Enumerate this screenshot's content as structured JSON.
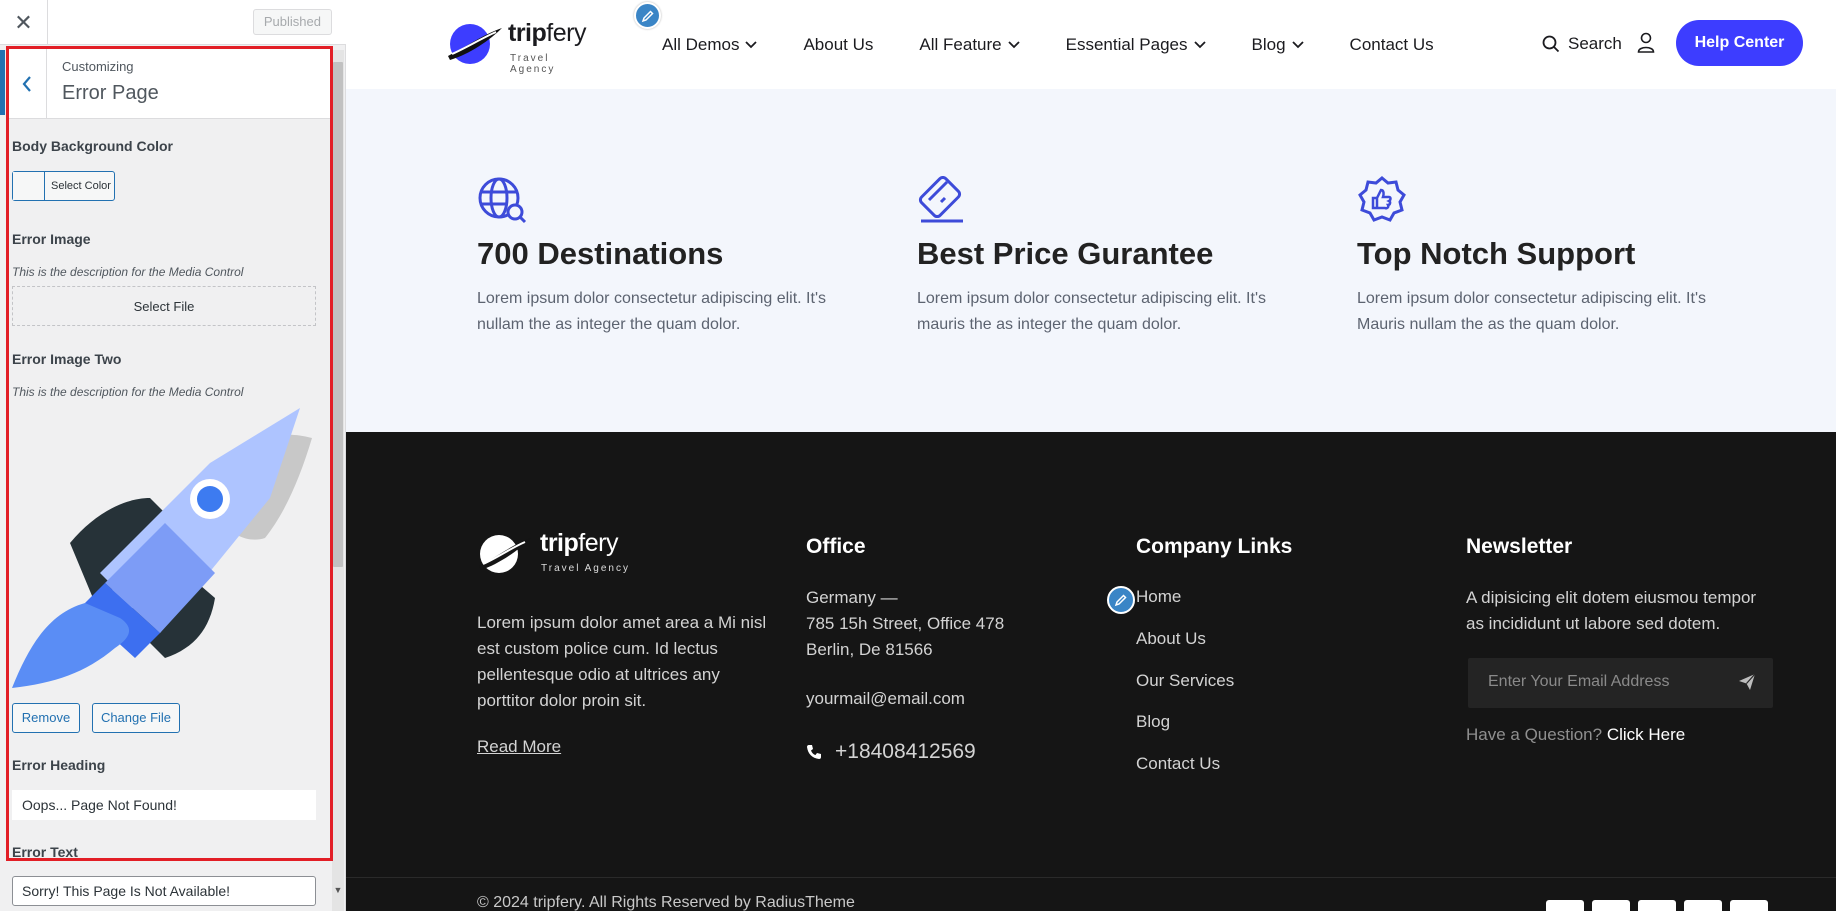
{
  "sidebar": {
    "close_icon": "close-icon",
    "published_label": "Published",
    "customizing_label": "Customizing",
    "section_title": "Error Page",
    "body_bg_label": "Body Background Color",
    "select_color_label": "Select Color",
    "error_image_label": "Error Image",
    "media_desc": "This is the description for the Media Control",
    "select_file_label": "Select File",
    "error_image_two_label": "Error Image Two",
    "media_desc_two": "This is the description for the Media Control",
    "remove_label": "Remove",
    "change_file_label": "Change File",
    "error_heading_label": "Error Heading",
    "error_heading_value": "Oops... Page Not Found!",
    "error_text_label": "Error Text",
    "error_text_value": "Sorry! This Page Is Not Available!",
    "highlight_color": "#e21e26",
    "accent_color": "#2271b1"
  },
  "site": {
    "logo_word_trip": "trip",
    "logo_word_fery": "fery",
    "logo_tag": "Travel Agency",
    "nav": [
      {
        "label": "All Demos",
        "dropdown": true
      },
      {
        "label": "About Us",
        "dropdown": false
      },
      {
        "label": "All Feature",
        "dropdown": true
      },
      {
        "label": "Essential Pages",
        "dropdown": true
      },
      {
        "label": "Blog",
        "dropdown": true
      },
      {
        "label": "Contact Us",
        "dropdown": false
      }
    ],
    "search_label": "Search",
    "help_label": "Help Center",
    "brand_color": "#3d3dff",
    "features": [
      {
        "icon": "globe-search-icon",
        "title": "700 Destinations",
        "desc": "Lorem ipsum dolor consectetur adipiscing elit. It's nullam the as integer the quam dolor."
      },
      {
        "icon": "card-icon",
        "title": "Best Price Gurantee",
        "desc": "Lorem ipsum dolor consectetur adipiscing elit. It's mauris the as integer the quam dolor."
      },
      {
        "icon": "thumbs-up-badge-icon",
        "title": "Top Notch Support",
        "desc": "Lorem ipsum dolor consectetur adipiscing elit. It's Mauris nullam the as the quam dolor."
      }
    ],
    "footer": {
      "about_text": "Lorem ipsum dolor amet area a Mi nisl est custom police cum. Id lectus pellentesque odio at ultrices any porttitor dolor proin sit.",
      "read_more": "Read More",
      "office_heading": "Office",
      "office_country": "Germany —",
      "office_street": "785 15h Street, Office 478",
      "office_city": "Berlin, De 81566",
      "office_email": "yourmail@email.com",
      "office_phone": "+18408412569",
      "links_heading": "Company Links",
      "links": [
        "Home",
        "About Us",
        "Our Services",
        "Blog",
        "Contact Us"
      ],
      "newsletter_heading": "Newsletter",
      "newsletter_text": "A dipisicing elit dotem eiusmou tempor as incididunt ut labore sed dotem.",
      "email_placeholder": "Enter Your Email Address",
      "question_text": "Have a Question?",
      "question_link": "Click Here",
      "copyright": "© 2024 tripfery. All Rights Reserved by RadiusTheme"
    }
  }
}
